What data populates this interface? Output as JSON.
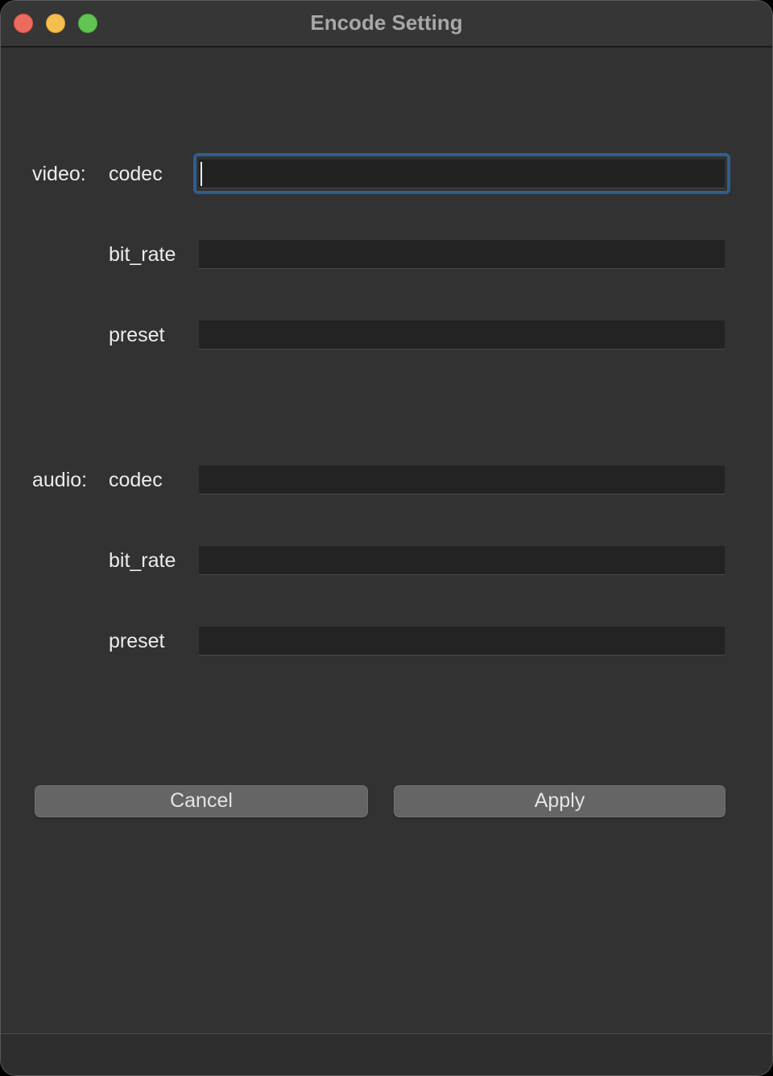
{
  "window": {
    "title": "Encode Setting"
  },
  "video": {
    "group_label": "video:",
    "fields": [
      {
        "label": "codec",
        "value": ""
      },
      {
        "label": "bit_rate",
        "value": ""
      },
      {
        "label": "preset",
        "value": ""
      }
    ]
  },
  "audio": {
    "group_label": "audio:",
    "fields": [
      {
        "label": "codec",
        "value": ""
      },
      {
        "label": "bit_rate",
        "value": ""
      },
      {
        "label": "preset",
        "value": ""
      }
    ]
  },
  "buttons": {
    "cancel": "Cancel",
    "apply": "Apply"
  },
  "colors": {
    "background": "#323232",
    "field_background": "#232323",
    "focus_ring": "#2d5f8f",
    "button": "#656565",
    "close_light": "#ed6a5e",
    "minimize_light": "#f5bf4f",
    "maximize_light": "#61c554"
  },
  "icons": [
    "close-icon",
    "minimize-icon",
    "maximize-icon"
  ]
}
